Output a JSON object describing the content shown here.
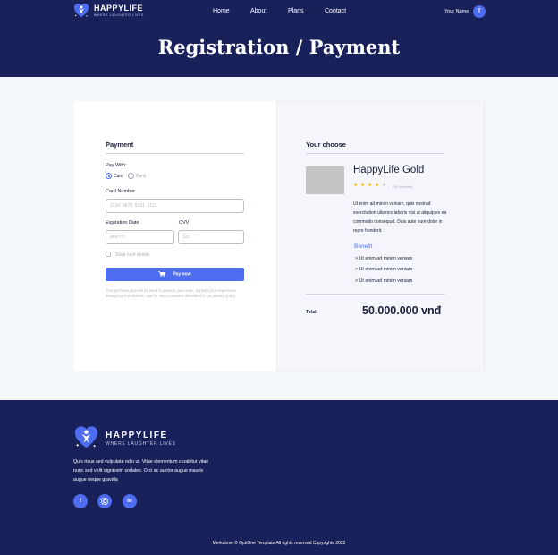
{
  "brand": {
    "name": "HAPPYLIFE",
    "tagline": "WHERE LAUGHTER LIVES"
  },
  "nav": {
    "items": [
      {
        "label": "Home"
      },
      {
        "label": "About"
      },
      {
        "label": "Plans"
      },
      {
        "label": "Contact"
      }
    ],
    "user_name": "Your Name",
    "avatar_initial": "T"
  },
  "page": {
    "title": "Registration / Payment"
  },
  "payment": {
    "title": "Payment",
    "pay_with_label": "Pay With:",
    "methods": [
      {
        "label": "Card",
        "selected": true
      },
      {
        "label": "Bank",
        "selected": false
      }
    ],
    "card_number": {
      "label": "Card Number",
      "placeholder": "1234  5678  9101  1121",
      "value": ""
    },
    "expiration": {
      "label": "Expiration Date",
      "placeholder": "MM/YY",
      "value": ""
    },
    "cvv": {
      "label": "CVV",
      "placeholder": "123",
      "value": ""
    },
    "save_card_label": "Save card details",
    "save_card_checked": false,
    "pay_button": "Pay now",
    "disclaimer": "Your personal data will be used to process your order, support your experience throughout this website, and for other purposes described in our privacy policy."
  },
  "summary": {
    "title": "Your choose",
    "product_name": "HappyLife Gold",
    "rating": 4,
    "rating_max": 5,
    "reviews": "(10 reviews)",
    "description": "Ut enim ad minim veniam, quis nostrud exercitation ullamco laboris nisi ut aliquip ex ea commodo consequat. Duis aute irure dolor in repre henderit.",
    "benefit_title": "Benefit",
    "benefits": [
      {
        "label": "> Ut enim ad minim veniam"
      },
      {
        "label": "> Ut enim ad minim veniam"
      },
      {
        "label": "> Ut enim ad minim veniam"
      }
    ],
    "total_label": "Total:",
    "total_value": "50.000.000 vnđ"
  },
  "footer": {
    "text": "Quis risus sed vulputate odio ut. Vitae elementum curabitur vitae nunc sed velit dignissim sodales. Orci ac auctor augue mauris augue neque gravida",
    "socials": [
      {
        "icon": "facebook-icon",
        "glyph": "f"
      },
      {
        "icon": "instagram-icon",
        "glyph": ""
      },
      {
        "icon": "linkedin-icon",
        "glyph": "in"
      }
    ],
    "copyright": "Merkulove © OptiOne Template All rights reserved Copyrights 2022"
  },
  "colors": {
    "navy": "#19215b",
    "accent": "#4d6cf0",
    "star": "#f5b700",
    "page_bg": "#f3f6fb"
  }
}
